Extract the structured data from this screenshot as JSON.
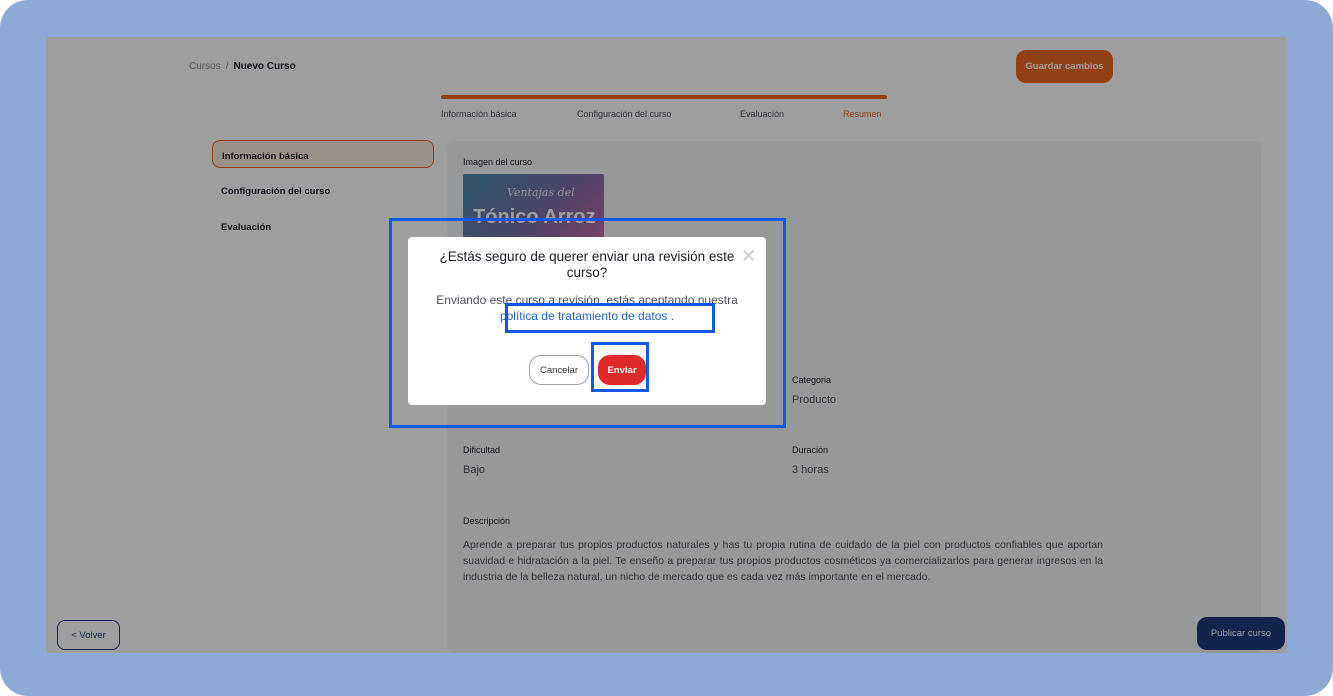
{
  "breadcrumb": {
    "root": "Cursos",
    "separator": "/",
    "current": "Nuevo Curso"
  },
  "header": {
    "save_label": "Guardar cambios"
  },
  "stepper": {
    "progress": 1.0,
    "steps": [
      "Información básica",
      "Configuración del curso",
      "Evaluación",
      "Resumen"
    ],
    "active_step": "Resumen"
  },
  "sidebar": {
    "items": [
      {
        "label": "Información básica",
        "active": true
      },
      {
        "label": "Configuración del curso",
        "active": false
      },
      {
        "label": "Evaluación",
        "active": false
      }
    ]
  },
  "content": {
    "image_label": "Imagen del curso",
    "image_script_text": "Ventajas del",
    "image_title_text": "Tónico Arroz",
    "category_label": "Categoria",
    "category_value": "Producto",
    "difficulty_label": "Dificultad",
    "difficulty_value": "Bajo",
    "duration_label": "Duración",
    "duration_value": "3 horas",
    "description_label": "Descripción",
    "description_text": "Aprende a preparar tus propios productos naturales y has tu propia rutina de cuidado de la piel con productos confiables que aportan suavidad e hidratación a la piel. Te enseño a preparar tus propios productos cosméticos ya comercializarlos para generar ingresos en la industria de la belleza natural, un nicho de mercado que es cada vez más importante en el mercado."
  },
  "footer": {
    "back_label": "< Volver",
    "publish_label": "Publicar curso"
  },
  "modal": {
    "title": "¿Estás seguro de querer enviar una revisión este curso?",
    "body_prefix": "Enviando este curso a revisión, estás aceptando nuestra ",
    "body_link": "política de tratamiento de datos",
    "body_suffix": " .",
    "cancel_label": "Cancelar",
    "send_label": "Enviar",
    "close_icon": "close-icon"
  },
  "colors": {
    "frame": "#8fa9d6",
    "accent_orange": "#ea6a22",
    "primary_blue": "#1e3a7a",
    "danger_red": "#e02a2a",
    "link_blue": "#1f66c4",
    "highlight_blue": "#1257e6"
  }
}
